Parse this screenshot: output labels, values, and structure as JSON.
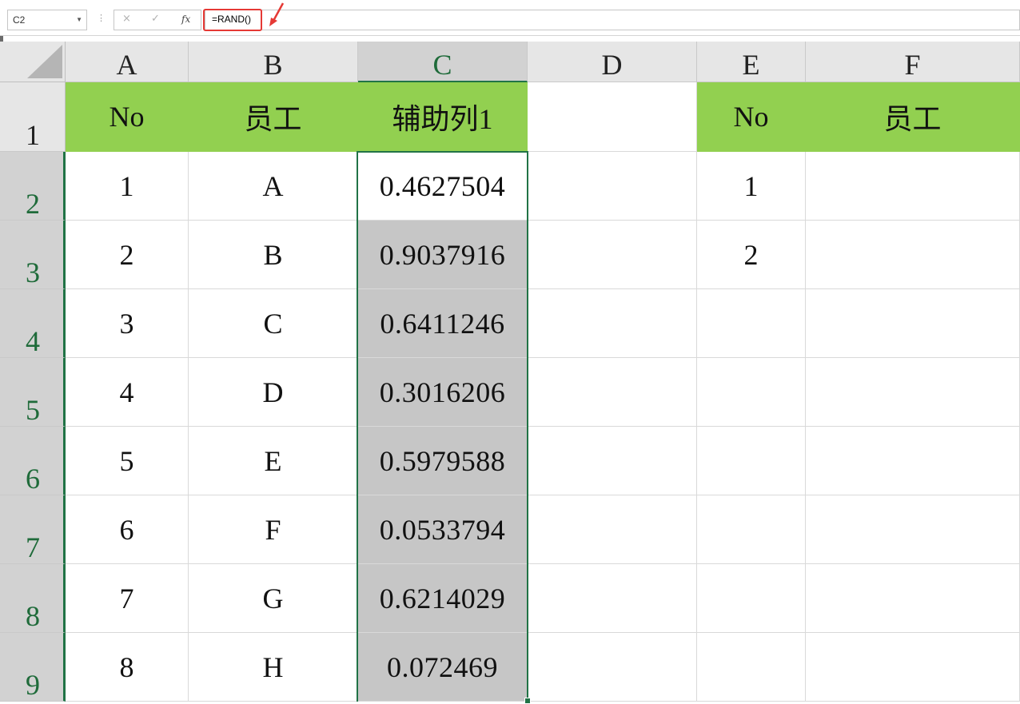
{
  "formula_bar": {
    "name_box": "C2",
    "separator": "⋮",
    "cancel_icon": "×",
    "enter_icon": "✓",
    "fx_label": "fx",
    "formula": "=RAND()"
  },
  "columns": [
    "A",
    "B",
    "C",
    "D",
    "E",
    "F"
  ],
  "rows": [
    "1",
    "2",
    "3",
    "4",
    "5",
    "6",
    "7",
    "8",
    "9"
  ],
  "header_row": {
    "A": "No",
    "B": "员工",
    "C": "辅助列1",
    "D": "",
    "E": "No",
    "F": "员工"
  },
  "data_rows": [
    {
      "A": "1",
      "B": "A",
      "C": "0.4627504",
      "E": "1"
    },
    {
      "A": "2",
      "B": "B",
      "C": "0.9037916",
      "E": "2"
    },
    {
      "A": "3",
      "B": "C",
      "C": "0.6411246",
      "E": ""
    },
    {
      "A": "4",
      "B": "D",
      "C": "0.3016206",
      "E": ""
    },
    {
      "A": "5",
      "B": "E",
      "C": "0.5979588",
      "E": ""
    },
    {
      "A": "6",
      "B": "F",
      "C": "0.0533794",
      "E": ""
    },
    {
      "A": "7",
      "B": "G",
      "C": "0.6214029",
      "E": ""
    },
    {
      "A": "8",
      "B": "H",
      "C": "0.072469",
      "E": ""
    }
  ],
  "colors": {
    "header_fill": "#92d050",
    "selection_fill": "#c6c6c6",
    "selection_border": "#217346",
    "annotation": "#e53935"
  }
}
